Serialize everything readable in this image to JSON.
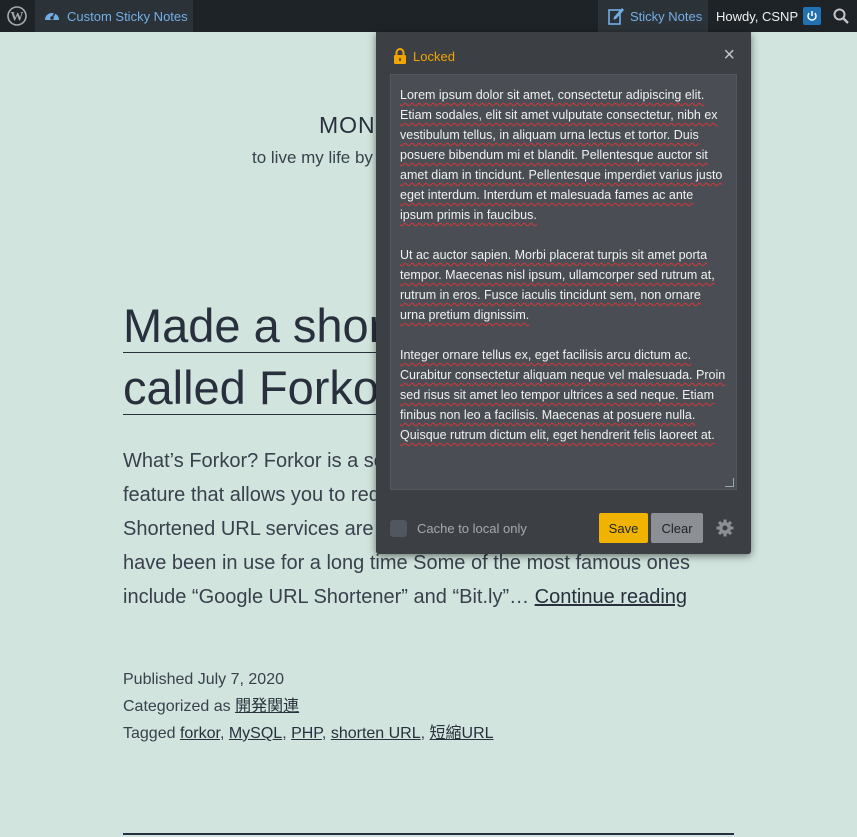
{
  "adminbar": {
    "site_name": "Custom Sticky Notes",
    "sticky_notes_label": "Sticky Notes",
    "howdy": "Howdy, CSNP"
  },
  "site": {
    "title": "MON",
    "description": "to live my life by"
  },
  "post": {
    "title_line1": "Made a shor",
    "title_line2": "called Forko",
    "excerpt_lines": [
      "What’s Forkor? Forkor is a se",
      "feature that allows you to red",
      "Shortened URL services are w",
      "have been in use for a long time Some of the most famous ones",
      "include “Google URL Shortener” and “Bit.ly”… "
    ],
    "continue_label": "Continue reading",
    "published_prefix": "Published ",
    "published_date": "July 7, 2020",
    "categorized_prefix": "Categorized as ",
    "category": "開発関連",
    "tagged_prefix": "Tagged ",
    "tags": [
      "forkor",
      "MySQL",
      "PHP",
      "shorten URL",
      "短縮URL"
    ]
  },
  "sticky": {
    "status": "Locked",
    "close_glyph": "×",
    "paragraphs": [
      "Lorem ipsum dolor sit amet, consectetur adipiscing elit. Etiam sodales, elit sit amet vulputate consectetur, nibh ex vestibulum tellus, in aliquam urna lectus et tortor. Duis posuere bibendum mi et blandit. Pellentesque auctor sit amet diam in tincidunt. Pellentesque imperdiet varius justo eget interdum. Interdum et malesuada fames ac ante ipsum primis in faucibus.",
      "Ut ac auctor sapien. Morbi placerat turpis sit amet porta tempor. Maecenas nisl ipsum, ullamcorper sed rutrum at, rutrum in eros. Fusce iaculis tincidunt sem, non ornare urna pretium dignissim.",
      "Integer ornare tellus ex, eget facilisis arcu dictum ac. Curabitur consectetur aliquam neque vel malesuada. Proin sed risus sit amet leo tempor ultrices a sed neque. Etiam finibus non leo a facilisis. Maecenas at posuere nulla. Quisque rutrum dictum elit, eget hendrerit felis laoreet at."
    ],
    "cache_label": "Cache to local only",
    "cache_checked": false,
    "save_label": "Save",
    "clear_label": "Clear",
    "accent_color": "#f0b400"
  }
}
